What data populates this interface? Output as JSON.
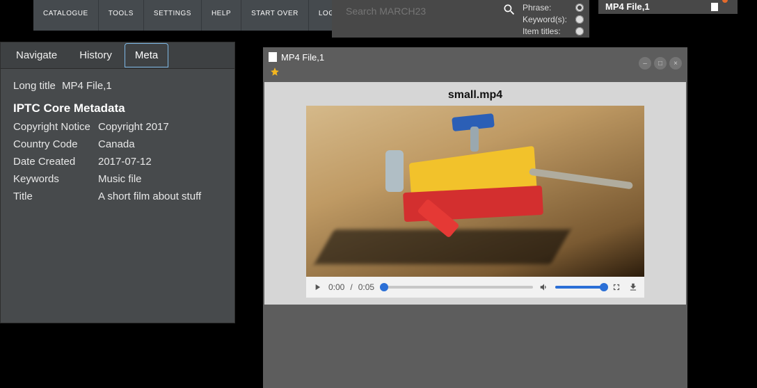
{
  "nav": {
    "items": [
      "CATALOGUE",
      "TOOLS",
      "SETTINGS",
      "HELP",
      "START OVER",
      "LOG OUT"
    ]
  },
  "search": {
    "placeholder": "Search MARCH23",
    "options": {
      "phrase": "Phrase:",
      "keywords": "Keyword(s):",
      "item_titles": "Item titles:"
    }
  },
  "thumbStrip": {
    "title": "MP4 File,1"
  },
  "sidebar": {
    "tabs": {
      "navigate": "Navigate",
      "history": "History",
      "meta": "Meta"
    },
    "active_tab": "meta",
    "long_title_label": "Long title",
    "long_title_value": "MP4 File,1",
    "section_heading": "IPTC Core Metadata",
    "rows": [
      {
        "k": "Copyright Notice",
        "v": "Copyright 2017"
      },
      {
        "k": "Country Code",
        "v": "Canada"
      },
      {
        "k": "Date Created",
        "v": "2017-07-12"
      },
      {
        "k": "Keywords",
        "v": "Music file"
      },
      {
        "k": "Title",
        "v": "A short film about stuff"
      }
    ]
  },
  "viewer": {
    "title": "MP4 File,1",
    "filename": "small.mp4",
    "time_current": "0:00",
    "time_sep": "/",
    "time_total": "0:05"
  }
}
